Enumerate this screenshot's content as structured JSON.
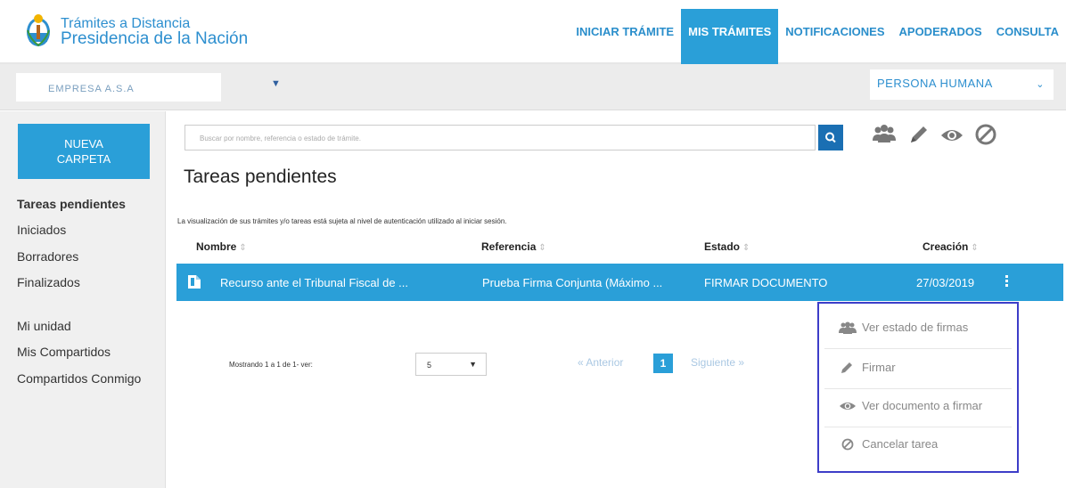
{
  "header": {
    "brand_line1": "Trámites a Distancia",
    "brand_line2": "Presidencia de la Nación",
    "nav": [
      {
        "label": "INICIAR TRÁMITE",
        "active": false
      },
      {
        "label": "MIS TRÁMITES",
        "active": true
      },
      {
        "label": "NOTIFICACIONES",
        "active": false
      },
      {
        "label": "APODERADOS",
        "active": false
      },
      {
        "label": "CONSULTA",
        "active": false
      }
    ]
  },
  "subbar": {
    "company_value": "EMPRESA A.S.A",
    "persona_value": "PERSONA HUMANA"
  },
  "sidebar": {
    "new_folder_label_1": "NUEVA",
    "new_folder_label_2": "CARPETA",
    "group1": [
      "Tareas pendientes",
      "Iniciados",
      "Borradores",
      "Finalizados"
    ],
    "group2": [
      "Mi unidad",
      "Mis Compartidos",
      "Compartidos Conmigo"
    ]
  },
  "main": {
    "search_placeholder": "Buscar por nombre, referencia o estado de trámite.",
    "title": "Tareas pendientes",
    "auth_note": "La visualización de sus trámites y/o tareas está sujeta al nivel de autenticación utilizado al iniciar sesión.",
    "columns": [
      "Nombre",
      "Referencia",
      "Estado",
      "Creación"
    ],
    "rows": [
      {
        "nombre": "Recurso ante el Tribunal Fiscal de ...",
        "referencia": "Prueba Firma Conjunta (Máximo ...",
        "estado": "FIRMAR DOCUMENTO",
        "creacion": "27/03/2019"
      }
    ],
    "showing": "Mostrando 1 a 1 de 1- ver:",
    "page_size": "5",
    "pager_prev": "« Anterior",
    "pager_current": "1",
    "pager_next": "Siguiente »"
  },
  "context_menu": [
    {
      "label": "Ver estado de firmas",
      "icon": "users-icon"
    },
    {
      "label": "Firmar",
      "icon": "pencil-icon"
    },
    {
      "label": "Ver documento a firmar",
      "icon": "eye-icon"
    },
    {
      "label": "Cancelar tarea",
      "icon": "ban-icon"
    }
  ],
  "colors": {
    "primary": "#2a9fd8",
    "dark_button": "#1a6fb3",
    "highlight_border": "#3d3dc8"
  }
}
